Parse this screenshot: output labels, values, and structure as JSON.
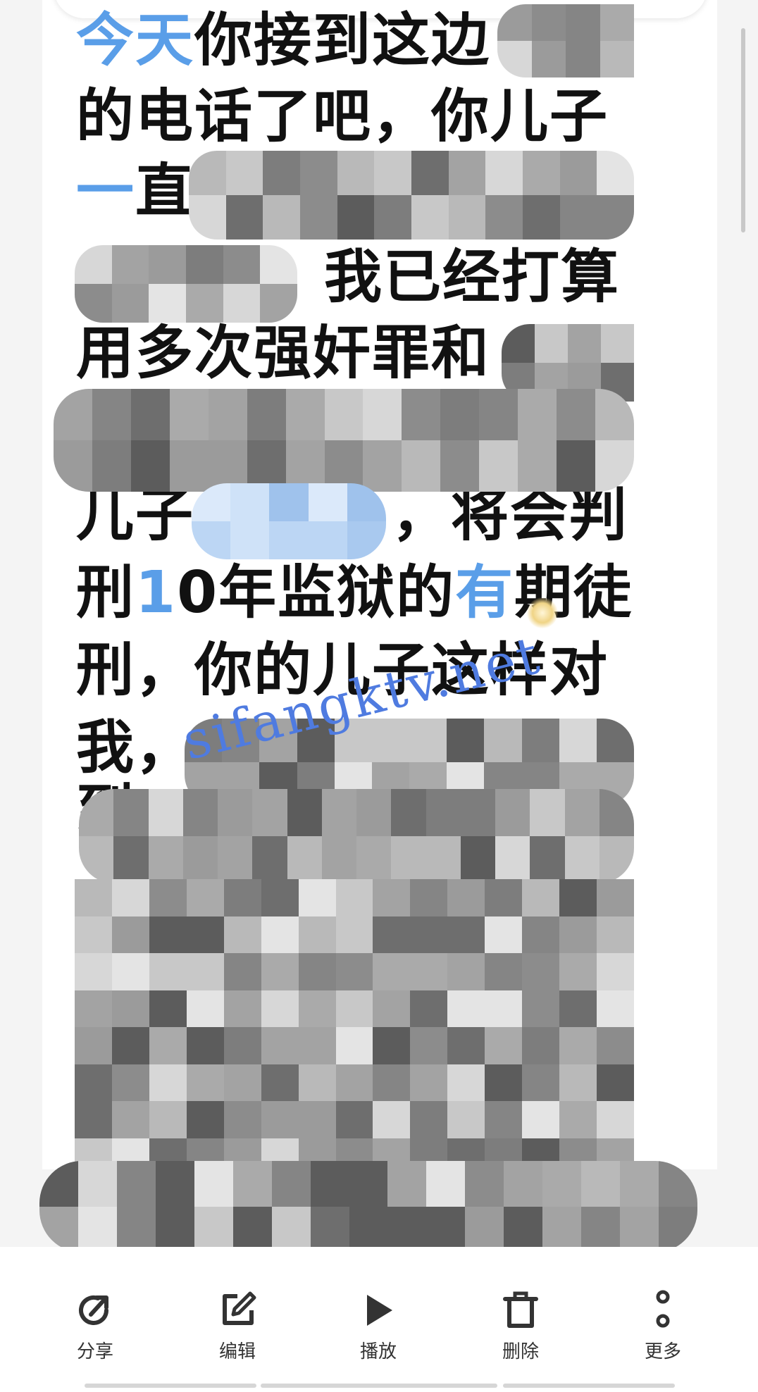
{
  "article": {
    "lines": [
      {
        "segments": [
          {
            "text": "今天",
            "blue": true
          },
          {
            "text": "你接到这边",
            "blue": false
          }
        ]
      },
      {
        "segments": [
          {
            "text": "的电话了吧，你儿子",
            "blue": false
          }
        ]
      },
      {
        "segments": [
          {
            "text": "一",
            "blue": true
          },
          {
            "text": "直",
            "blue": false
          }
        ]
      },
      {
        "segments": [
          {
            "text": "我已经打算",
            "blue": false
          }
        ]
      },
      {
        "segments": [
          {
            "text": "用多次强奸罪和",
            "blue": false
          }
        ]
      },
      {
        "segments": [
          {
            "text": "儿子",
            "blue": false
          }
        ]
      },
      {
        "segments": [
          {
            "text": "，将会判",
            "blue": false
          }
        ]
      },
      {
        "segments": [
          {
            "text": "刑",
            "blue": false
          },
          {
            "text": "1",
            "blue": true
          },
          {
            "text": "0年监狱的",
            "blue": false
          },
          {
            "text": "有",
            "blue": true
          },
          {
            "text": "期徒",
            "blue": false
          }
        ]
      },
      {
        "segments": [
          {
            "text": "刑，你的儿子这样对",
            "blue": false
          }
        ]
      },
      {
        "segments": [
          {
            "text": "我，",
            "blue": false
          }
        ]
      },
      {
        "segments": [
          {
            "text": "到",
            "blue": false
          }
        ]
      }
    ]
  },
  "watermark": "sifangktv.net",
  "toolbar": {
    "share_label": "分享",
    "edit_label": "编辑",
    "play_label": "播放",
    "delete_label": "删除",
    "more_label": "更多"
  },
  "colors": {
    "accent_blue": "#5a9ee8",
    "watermark_blue": "#4f7be0",
    "text": "#111111",
    "icon": "#333333"
  },
  "icons": [
    "share-icon",
    "edit-icon",
    "play-icon",
    "delete-icon",
    "more-icon"
  ]
}
